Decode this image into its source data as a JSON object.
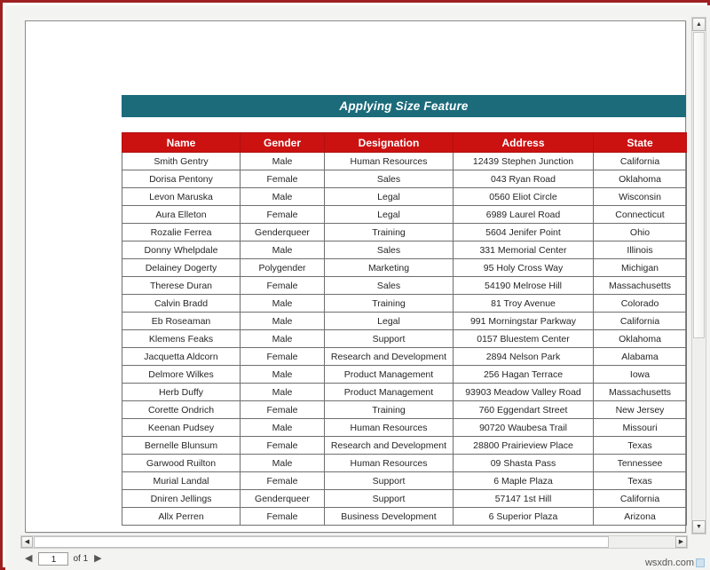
{
  "report": {
    "title": "Applying Size Feature",
    "title_bg": "#1b6b7b",
    "header_bg": "#cc1111",
    "columns": [
      "Name",
      "Gender",
      "Designation",
      "Address",
      "State"
    ],
    "rows": [
      [
        "Smith Gentry",
        "Male",
        "Human Resources",
        "12439 Stephen Junction",
        "California"
      ],
      [
        "Dorisa Pentony",
        "Female",
        "Sales",
        "043 Ryan Road",
        "Oklahoma"
      ],
      [
        "Levon Maruska",
        "Male",
        "Legal",
        "0560 Eliot Circle",
        "Wisconsin"
      ],
      [
        "Aura Elleton",
        "Female",
        "Legal",
        "6989 Laurel Road",
        "Connecticut"
      ],
      [
        "Rozalie Ferrea",
        "Genderqueer",
        "Training",
        "5604 Jenifer Point",
        "Ohio"
      ],
      [
        "Donny Whelpdale",
        "Male",
        "Sales",
        "331 Memorial Center",
        "Illinois"
      ],
      [
        "Delainey Dogerty",
        "Polygender",
        "Marketing",
        "95 Holy Cross Way",
        "Michigan"
      ],
      [
        "Therese Duran",
        "Female",
        "Sales",
        "54190 Melrose Hill",
        "Massachusetts"
      ],
      [
        "Calvin Bradd",
        "Male",
        "Training",
        "81 Troy Avenue",
        "Colorado"
      ],
      [
        "Eb Roseaman",
        "Male",
        "Legal",
        "991 Morningstar Parkway",
        "California"
      ],
      [
        "Klemens Feaks",
        "Male",
        "Support",
        "0157 Bluestem Center",
        "Oklahoma"
      ],
      [
        "Jacquetta Aldcorn",
        "Female",
        "Research and Development",
        "2894 Nelson Park",
        "Alabama"
      ],
      [
        "Delmore Wilkes",
        "Male",
        "Product Management",
        "256 Hagan Terrace",
        "Iowa"
      ],
      [
        "Herb Duffy",
        "Male",
        "Product Management",
        "93903 Meadow Valley Road",
        "Massachusetts"
      ],
      [
        "Corette Ondrich",
        "Female",
        "Training",
        "760 Eggendart Street",
        "New Jersey"
      ],
      [
        "Keenan Pudsey",
        "Male",
        "Human Resources",
        "90720 Waubesa Trail",
        "Missouri"
      ],
      [
        "Bernelle Blunsum",
        "Female",
        "Research and Development",
        "28800 Prairieview Place",
        "Texas"
      ],
      [
        "Garwood Ruilton",
        "Male",
        "Human Resources",
        "09 Shasta Pass",
        "Tennessee"
      ],
      [
        "Murial Landal",
        "Female",
        "Support",
        "6 Maple Plaza",
        "Texas"
      ],
      [
        "Dniren Jellings",
        "Genderqueer",
        "Support",
        "57147 1st Hill",
        "California"
      ],
      [
        "Allx Perren",
        "Female",
        "Business Development",
        "6 Superior Plaza",
        "Arizona"
      ]
    ]
  },
  "pager": {
    "prev_icon": "◀",
    "next_icon": "▶",
    "current_page": "1",
    "of_label": "of 1"
  },
  "scrollbars": {
    "up_icon": "▲",
    "down_icon": "▼",
    "left_icon": "◀",
    "right_icon": "▶"
  },
  "watermark": {
    "text": "wsxdn.com"
  }
}
